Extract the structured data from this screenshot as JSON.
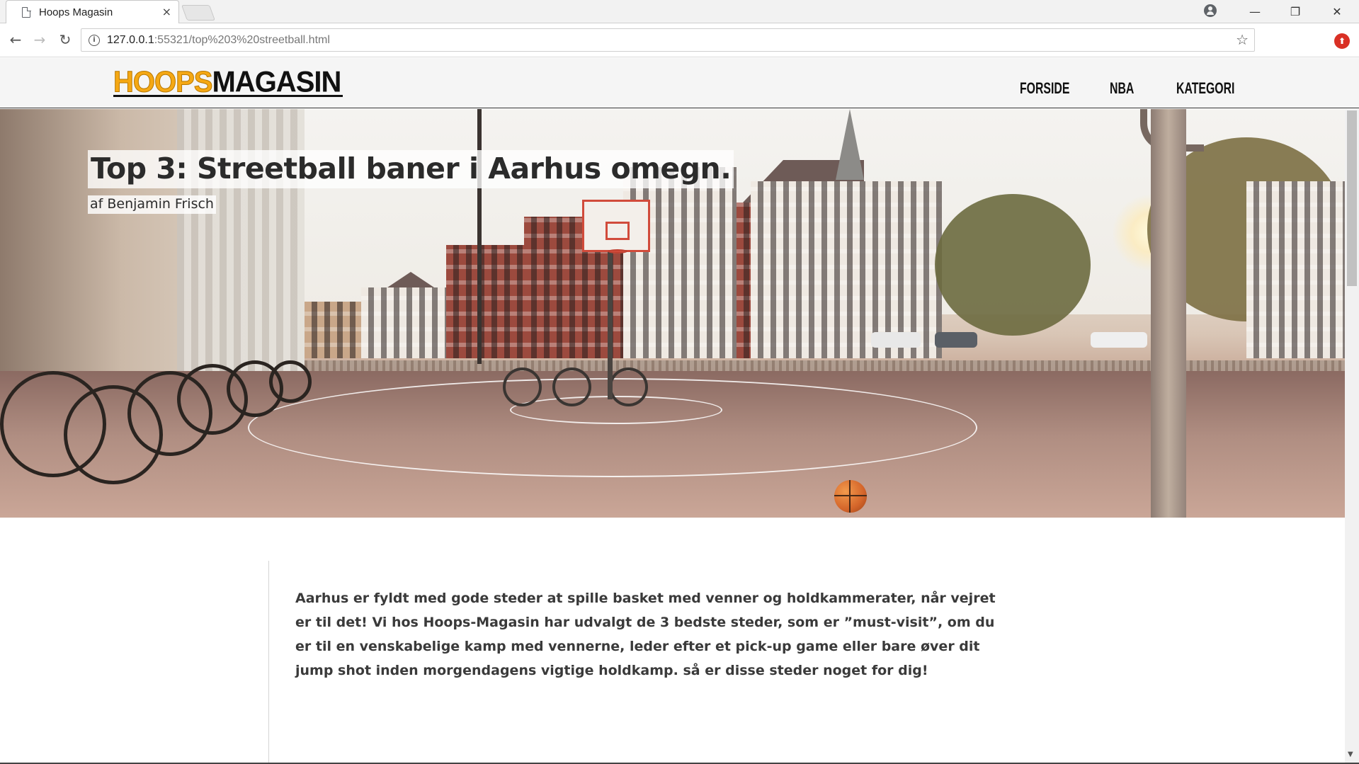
{
  "browser": {
    "tab_title": "Hoops Magasin",
    "tab_close": "×",
    "url_host": "127.0.0.1",
    "url_rest": ":55321/top%203%20streetball.html",
    "back": "←",
    "forward": "→",
    "reload": "↻",
    "star": "☆",
    "minimize": "—",
    "restore": "❐",
    "close": "✕",
    "info": "i"
  },
  "site": {
    "logo_hoops": "HOOPS",
    "logo_magasin": "MAGASIN",
    "nav": {
      "forside": "FORSIDE",
      "nba": "NBA",
      "kategori": "KATEGORI"
    }
  },
  "hero": {
    "title": "Top 3: Streetball baner i Aarhus omegn.",
    "author": "af Benjamin Frisch"
  },
  "article": {
    "intro": "Aarhus er fyldt med gode steder at spille basket med venner og holdkammerater, når vejret er til det! Vi hos Hoops-Magasin har udvalgt de 3 bedste steder, som er ”must-visit”, om du er til en venskabelige kamp med vennerne, leder efter et pick-up game eller bare øver dit jump shot inden morgendagens vigtige holdkamp. så er disse steder noget for dig!"
  },
  "icons": {
    "tab": "document-icon",
    "profile": "profile-icon",
    "extension": "extension-icon",
    "ball": "basketball"
  },
  "colors": {
    "logo_accent": "#f5a814",
    "logo_dark": "#111111",
    "hoop_red": "#d14b3b"
  }
}
